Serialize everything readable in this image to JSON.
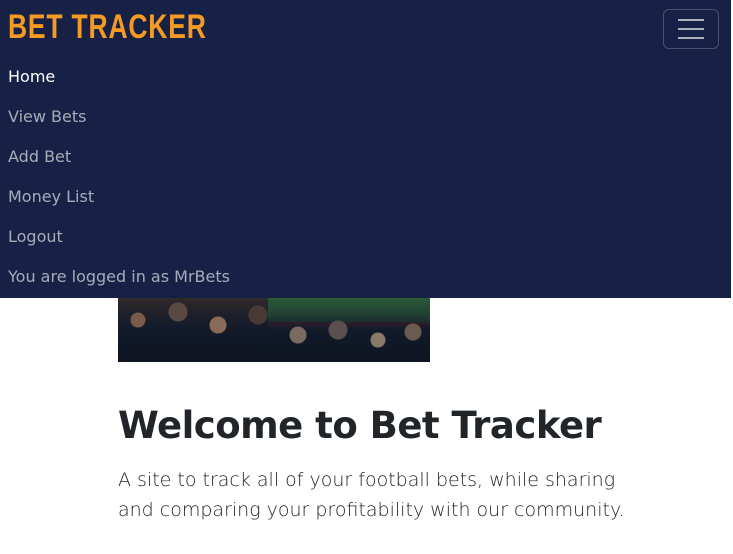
{
  "navbar": {
    "brand": "BET TRACKER",
    "items": [
      {
        "label": "Home",
        "active": true
      },
      {
        "label": "View Bets",
        "active": false
      },
      {
        "label": "Add Bet",
        "active": false
      },
      {
        "label": "Money List",
        "active": false
      },
      {
        "label": "Logout",
        "active": false
      },
      {
        "label": "You are logged in as MrBets",
        "active": false
      }
    ],
    "toggler_icon": "hamburger-menu-icon"
  },
  "main": {
    "hero_image": "stadium-crowd-image",
    "title": "Welcome to Bet Tracker",
    "lead": "A site to track all of your football bets, while sharing and comparing your profitability with our community."
  },
  "colors": {
    "navbar_bg": "#162145",
    "brand": "#f59a23",
    "text": "#212529"
  }
}
